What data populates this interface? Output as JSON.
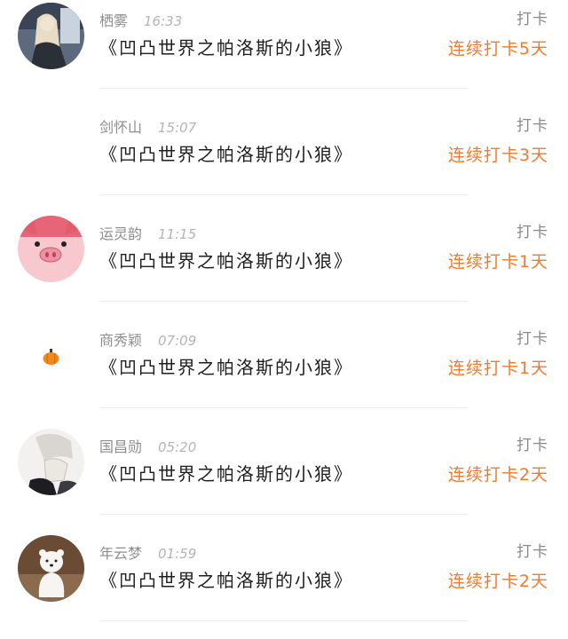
{
  "colors": {
    "streak": "#f37a2d",
    "name": "#8e8e8e",
    "time": "#b4b4b4",
    "divider": "#ececec"
  },
  "entries": [
    {
      "name": "栖雾",
      "time": "16:33",
      "book": "《凹凸世界之帕洛斯的小狼》",
      "action": "打卡",
      "streak": "连续打卡5天",
      "avatar": "girl-photo"
    },
    {
      "name": "剑怀山",
      "time": "15:07",
      "book": "《凹凸世界之帕洛斯的小狼》",
      "action": "打卡",
      "streak": "连续打卡3天",
      "avatar": "blank"
    },
    {
      "name": "运灵韵",
      "time": "11:15",
      "book": "《凹凸世界之帕洛斯的小狼》",
      "action": "打卡",
      "streak": "连续打卡1天",
      "avatar": "pink-pig"
    },
    {
      "name": "商秀颖",
      "time": "07:09",
      "book": "《凹凸世界之帕洛斯的小狼》",
      "action": "打卡",
      "streak": "连续打卡1天",
      "avatar": "pumpkin"
    },
    {
      "name": "国昌勋",
      "time": "05:20",
      "book": "《凹凸世界之帕洛斯的小狼》",
      "action": "打卡",
      "streak": "连续打卡2天",
      "avatar": "anime-sketch"
    },
    {
      "name": "年云梦",
      "time": "01:59",
      "book": "《凹凸世界之帕洛斯的小狼》",
      "action": "打卡",
      "streak": "连续打卡2天",
      "avatar": "white-bear"
    }
  ]
}
